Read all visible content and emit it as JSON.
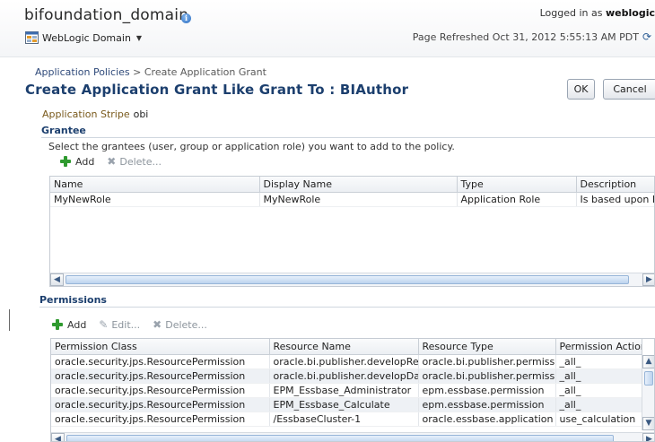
{
  "header": {
    "domain_title": "bifoundation_domain",
    "info_icon": "i",
    "menu_label": "WebLogic Domain",
    "logged_in_prefix": "Logged in as",
    "logged_in_user": "weblogic",
    "page_refreshed": "Page Refreshed Oct 31, 2012 5:55:13 AM PDT"
  },
  "breadcrumb": {
    "link": "Application Policies",
    "separator": ">",
    "current": "Create Application Grant"
  },
  "page_title": "Create Application Grant Like Grant To : BIAuthor",
  "buttons": {
    "ok": "OK",
    "cancel": "Cancel"
  },
  "stripe": {
    "label": "Application Stripe",
    "value": "obi"
  },
  "grantee": {
    "heading": "Grantee",
    "description": "Select the grantees (user, group or application role) you want to add to the policy.",
    "toolbar": {
      "add": "Add",
      "delete": "Delete..."
    },
    "columns": [
      "Name",
      "Display Name",
      "Type",
      "Description"
    ],
    "rows": [
      [
        "MyNewRole",
        "MyNewRole",
        "Application Role",
        "Is based upon BI"
      ]
    ]
  },
  "permissions": {
    "heading": "Permissions",
    "toolbar": {
      "add": "Add",
      "edit": "Edit...",
      "delete": "Delete..."
    },
    "columns": [
      "Permission Class",
      "Resource Name",
      "Resource Type",
      "Permission Action"
    ],
    "rows": [
      [
        "oracle.security.jps.ResourcePermission",
        "oracle.bi.publisher.developRepo",
        "oracle.bi.publisher.permission",
        "_all_"
      ],
      [
        "oracle.security.jps.ResourcePermission",
        "oracle.bi.publisher.developDatal",
        "oracle.bi.publisher.permission",
        "_all_"
      ],
      [
        "oracle.security.jps.ResourcePermission",
        "EPM_Essbase_Administrator",
        "epm.essbase.permission",
        "_all_"
      ],
      [
        "oracle.security.jps.ResourcePermission",
        "EPM_Essbase_Calculate",
        "epm.essbase.permission",
        "_all_"
      ],
      [
        "oracle.security.jps.ResourcePermission",
        "/EssbaseCluster-1",
        "oracle.essbase.application",
        "use_calculation"
      ]
    ]
  },
  "colors": {
    "title_blue": "#1c3f6e",
    "stripe_label": "#7a5a1c",
    "add_green": "#2f9a2f",
    "selected_row": "#eef1f5"
  },
  "icons": [
    "info-icon",
    "weblogic-domain-icon",
    "chevron-down-icon",
    "refresh-icon",
    "add-icon",
    "delete-icon",
    "edit-icon"
  ]
}
